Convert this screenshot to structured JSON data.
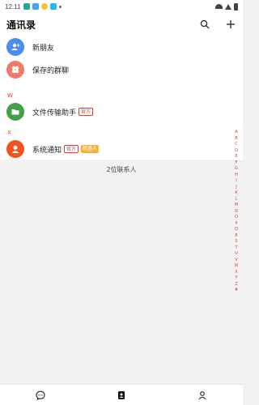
{
  "status_bar": {
    "time": "12:11",
    "icons": [
      "app-icon-teal",
      "app-icon-blue",
      "app-icon-yellow",
      "app-icon-blue2",
      "dot-icon"
    ]
  },
  "header": {
    "title": "通讯录",
    "search_icon": "search-icon",
    "add_icon": "plus-icon"
  },
  "top_items": [
    {
      "label": "新朋友",
      "icon": "person-add-icon",
      "color": "#4a8df0"
    },
    {
      "label": "保存的群聊",
      "icon": "group-icon",
      "color": "#f07b6b"
    }
  ],
  "sections": [
    {
      "letter": "W",
      "contacts": [
        {
          "label": "文件传输助手",
          "badge_official": "官方",
          "color": "#43a047",
          "icon": "folder-icon"
        }
      ]
    },
    {
      "letter": "X",
      "contacts": [
        {
          "label": "系统通知",
          "badge_official": "官方",
          "badge_bot": "机器人",
          "color": "#f4511e",
          "icon": "person-icon"
        }
      ]
    }
  ],
  "index_letters": [
    "A",
    "B",
    "C",
    "D",
    "E",
    "F",
    "G",
    "H",
    "I",
    "J",
    "K",
    "L",
    "M",
    "N",
    "O",
    "P",
    "Q",
    "R",
    "S",
    "T",
    "U",
    "V",
    "W",
    "X",
    "Y",
    "Z",
    "#"
  ],
  "contact_count": "2位联系人",
  "bottom_nav": [
    {
      "name": "chat-tab",
      "icon": "chat-icon"
    },
    {
      "name": "contacts-tab",
      "icon": "contacts-icon"
    },
    {
      "name": "profile-tab",
      "icon": "person-outline-icon"
    }
  ],
  "colors": {
    "accent": "#e53935",
    "background": "#f2f2f2",
    "official_badge": "#e53935",
    "bot_badge": "#f5b53a"
  }
}
